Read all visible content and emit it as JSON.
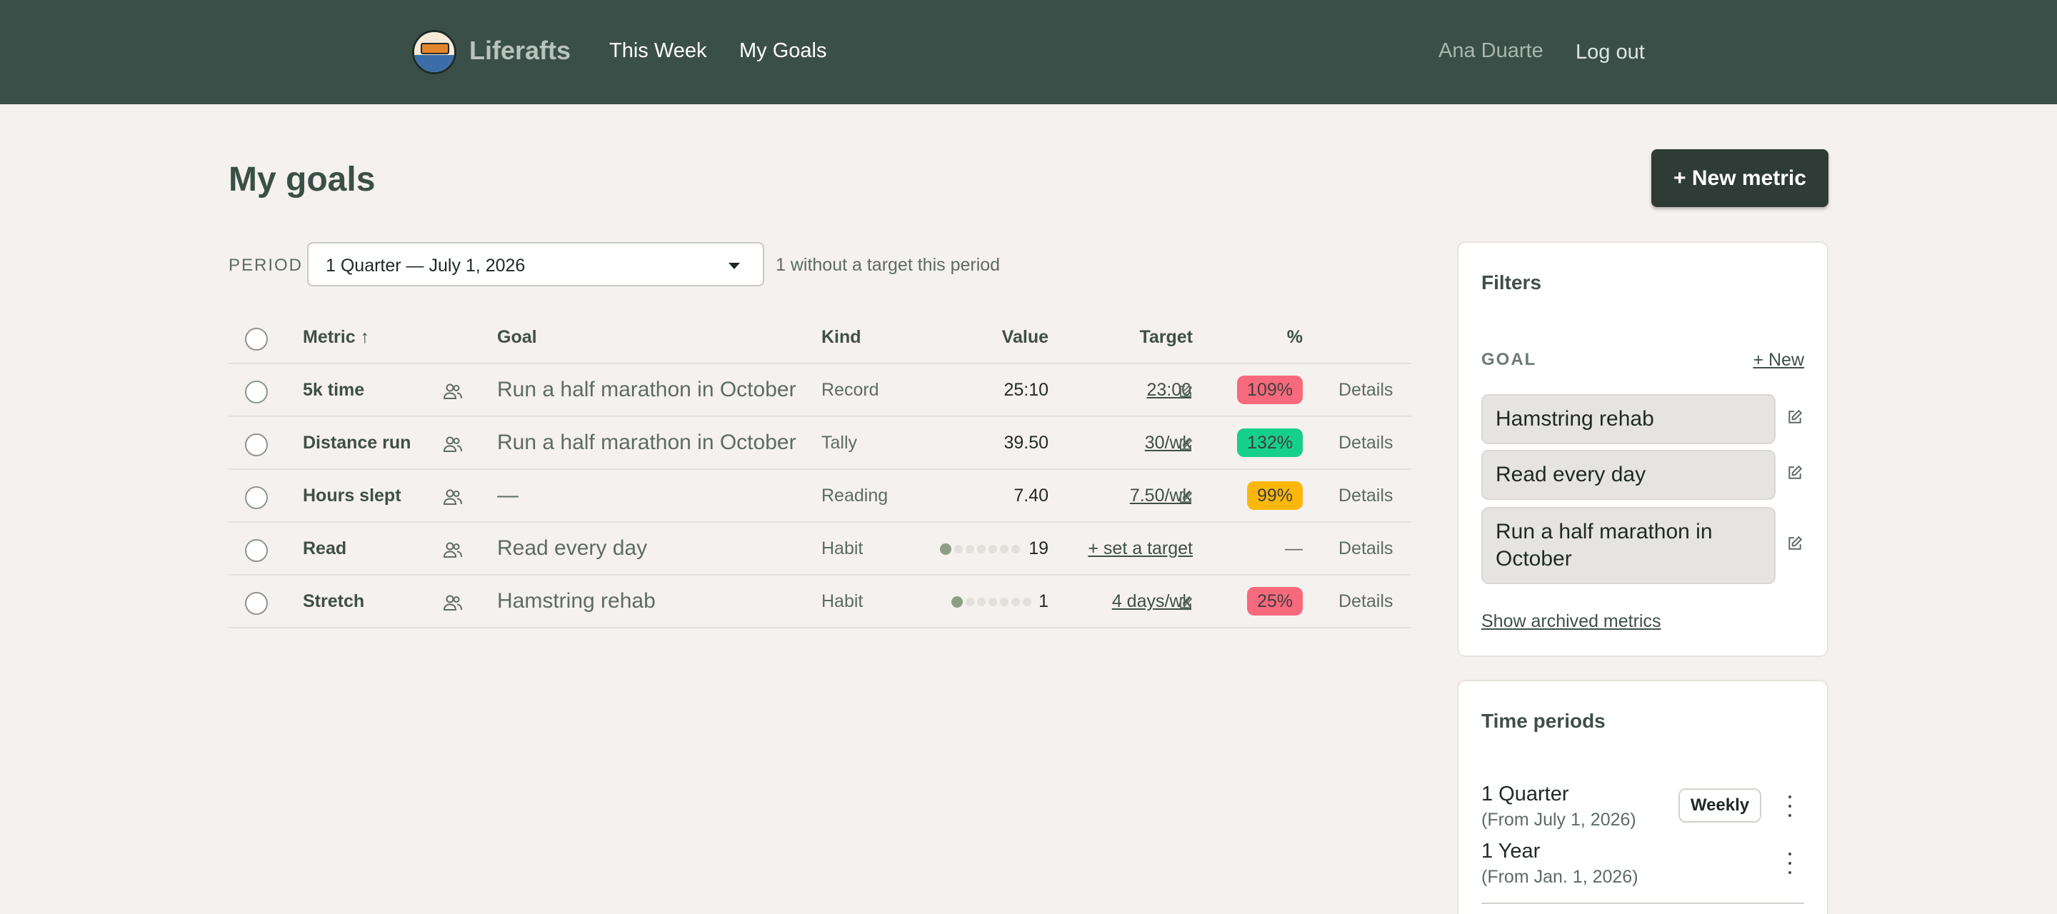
{
  "nav": {
    "brand": "Liferafts",
    "links": [
      "This Week",
      "My Goals"
    ],
    "user": "Ana Duarte",
    "logout": "Log out"
  },
  "page": {
    "title": "My goals",
    "new_metric": "+ New metric"
  },
  "period": {
    "label": "PERIOD",
    "selected": "1 Quarter — July 1, 2026",
    "note": "1 without a target this period"
  },
  "table": {
    "headers": {
      "metric": "Metric ↑",
      "goal": "Goal",
      "kind": "Kind",
      "value": "Value",
      "target": "Target",
      "percent": "%"
    },
    "rows": [
      {
        "metric": "5k time",
        "goal": "Run a half marathon in October",
        "kind": "Record",
        "value": "25:10",
        "target": "23:00",
        "percent": "109%",
        "details": "Details"
      },
      {
        "metric": "Distance run",
        "goal": "Run a half marathon in October",
        "kind": "Tally",
        "value": "39.50",
        "target": "30/wk",
        "percent": "132%",
        "details": "Details"
      },
      {
        "metric": "Hours slept",
        "goal": "—",
        "kind": "Reading",
        "value": "7.40",
        "target": "7.50/wk",
        "percent": "99%",
        "details": "Details"
      },
      {
        "metric": "Read",
        "goal": "Read every day",
        "kind": "Habit",
        "value": "19",
        "target": "+ set a target",
        "percent": "—",
        "details": "Details"
      },
      {
        "metric": "Stretch",
        "goal": "Hamstring rehab",
        "kind": "Habit",
        "value": "1",
        "target": "4 days/wk",
        "percent": "25%",
        "details": "Details"
      }
    ]
  },
  "colors": {
    "header_bg": "#3a4f48",
    "page_bg": "#f5f1ee",
    "pct_red": "#f7697c",
    "pct_green": "#16cf8b",
    "pct_amber": "#fbb70c",
    "habit_dot_on": "#8b9f85"
  },
  "filters": {
    "title": "Filters",
    "goal_label": "GOAL",
    "goal_new": "+ New",
    "goals": [
      "Hamstring rehab",
      "Read every day",
      "Run a half marathon in October"
    ],
    "archived": "Show archived metrics"
  },
  "time_periods": {
    "title": "Time periods",
    "items": [
      {
        "name": "1 Quarter",
        "from": "(From July 1, 2026)",
        "badge": "Weekly"
      },
      {
        "name": "1 Year",
        "from": "(From Jan. 1, 2026)"
      }
    ]
  },
  "icons": {
    "share": "people-icon",
    "edit": "edit-icon",
    "menu": "kebab-menu-icon"
  }
}
